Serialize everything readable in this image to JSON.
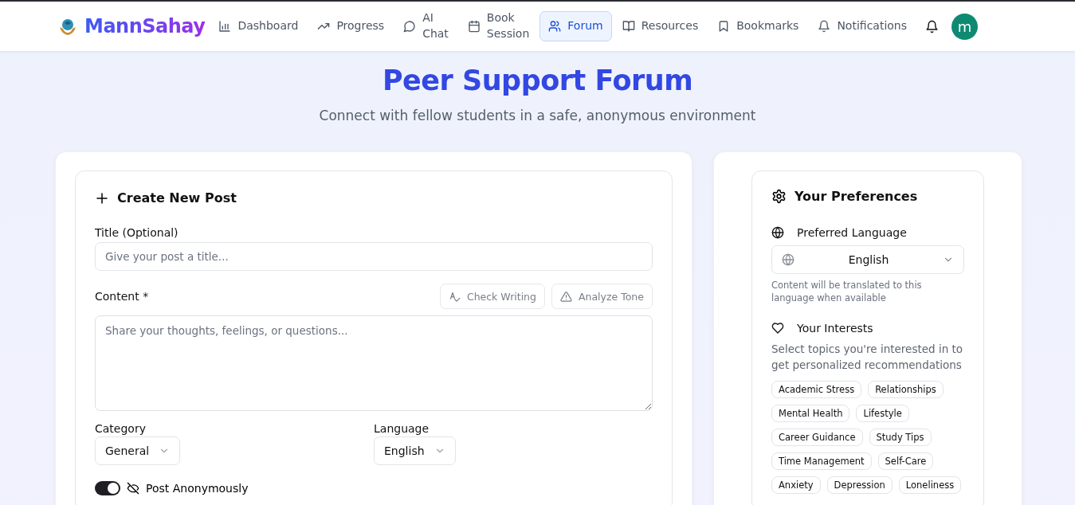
{
  "brand": {
    "name": "MannSahay"
  },
  "nav": [
    {
      "label": "Dashboard",
      "selected": false
    },
    {
      "label": "Progress",
      "selected": false
    },
    {
      "label": "AI Chat",
      "selected": false
    },
    {
      "label": "Book Session",
      "selected": false
    },
    {
      "label": "Forum",
      "selected": true
    },
    {
      "label": "Resources",
      "selected": false
    },
    {
      "label": "Bookmarks",
      "selected": false
    },
    {
      "label": "Notifications",
      "selected": false
    }
  ],
  "avatar": {
    "initial": "m"
  },
  "page": {
    "title": "Peer Support Forum",
    "subtitle": "Connect with fellow students in a safe, anonymous environment"
  },
  "create_post": {
    "heading": "Create New Post",
    "title_label": "Title (Optional)",
    "title_placeholder": "Give your post a title...",
    "content_label": "Content *",
    "tools": [
      "Check Writing",
      "Analyze Tone"
    ],
    "content_placeholder": "Share your thoughts, feelings, or questions...",
    "category_label": "Category",
    "category_value": "General",
    "language_label": "Language",
    "language_value": "English",
    "anonymous": {
      "label": "Post Anonymously",
      "on": true
    }
  },
  "preferences": {
    "heading": "Your Preferences",
    "language_label": "Preferred Language",
    "language_value": "English",
    "language_note": "Content will be translated to this language when available",
    "interests_label": "Your Interests",
    "interests_note": "Select topics you're interested in to get personalized recommendations",
    "topics": [
      {
        "label": "Academic Stress",
        "selected": false
      },
      {
        "label": "Relationships",
        "selected": false
      },
      {
        "label": "Mental Health",
        "selected": false
      },
      {
        "label": "Lifestyle",
        "selected": false
      },
      {
        "label": "Career Guidance",
        "selected": false
      },
      {
        "label": "Study Tips",
        "selected": false
      },
      {
        "label": "Time Management",
        "selected": false
      },
      {
        "label": "Self-Care",
        "selected": false
      },
      {
        "label": "Anxiety",
        "selected": false
      },
      {
        "label": "Depression",
        "selected": false
      },
      {
        "label": "Loneliness",
        "selected": false
      }
    ]
  }
}
